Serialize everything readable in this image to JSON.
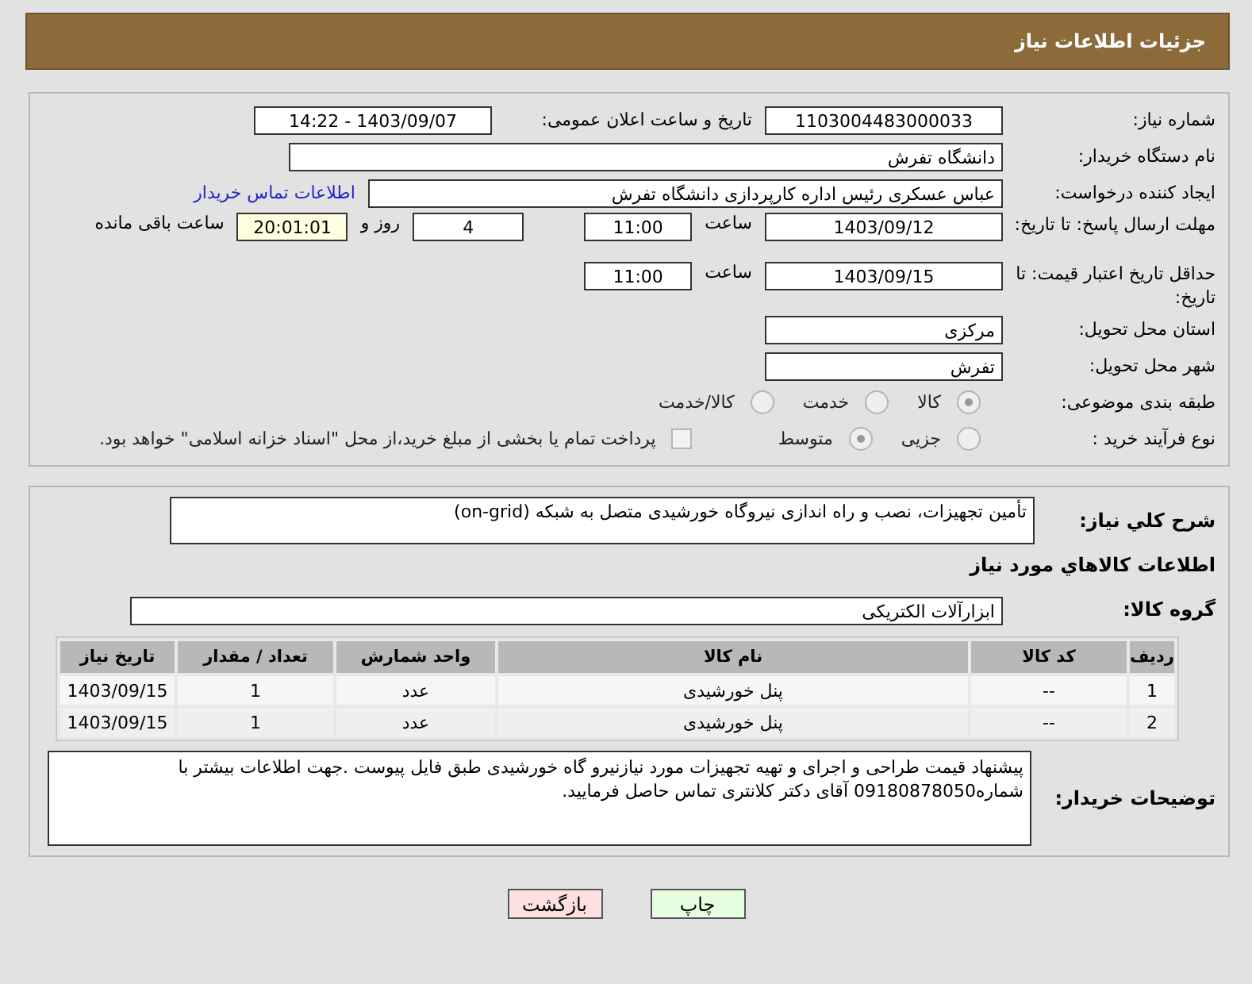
{
  "header": {
    "title": "جزئیات اطلاعات نیاز"
  },
  "need_number": {
    "label": "شماره نیاز:",
    "value": "1103004483000033"
  },
  "announce": {
    "label": "تاریخ و ساعت اعلان عمومی:",
    "value": "1403/09/07 - 14:22"
  },
  "buyer_org": {
    "label": "نام دستگاه خریدار:",
    "value": "دانشگاه تفرش"
  },
  "requester": {
    "label": "ایجاد کننده درخواست:",
    "value": "عباس عسکری رئیس اداره کارپردازی دانشگاه تفرش",
    "link": "اطلاعات تماس خریدار"
  },
  "response_deadline": {
    "label": "مهلت ارسال پاسخ: تا تاریخ:",
    "date": "1403/09/12",
    "time_label": "ساعت",
    "time": "11:00",
    "days": "4",
    "days_label": "روز و",
    "remaining": "20:01:01",
    "remaining_label": "ساعت باقی مانده"
  },
  "price_validity": {
    "label": "حداقل تاریخ اعتبار قیمت: تا تاریخ:",
    "date": "1403/09/15",
    "time_label": "ساعت",
    "time": "11:00"
  },
  "province": {
    "label": "استان محل تحویل:",
    "value": "مرکزی"
  },
  "city": {
    "label": "شهر محل تحویل:",
    "value": "تفرش"
  },
  "category": {
    "label": "طبقه بندی موضوعی:",
    "options": [
      {
        "label": "کالا",
        "selected": true
      },
      {
        "label": "خدمت",
        "selected": false
      },
      {
        "label": "کالا/خدمت",
        "selected": false
      }
    ]
  },
  "purchase_process": {
    "label": "نوع فرآیند خرید :",
    "options": [
      {
        "label": "جزیی",
        "selected": false
      },
      {
        "label": "متوسط",
        "selected": true
      }
    ],
    "treasury": {
      "label": "پرداخت تمام یا بخشی از مبلغ خرید،از محل \"اسناد خزانه اسلامی\" خواهد بود.",
      "checked": false
    }
  },
  "description": {
    "label": "شرح کلي نياز:",
    "value": "تأمین تجهیزات، نصب و راه اندازی نیروگاه خورشیدی متصل به شبکه (on-grid)"
  },
  "goods_heading": "اطلاعات کالاهاي مورد نياز",
  "goods_group": {
    "label": "گروه کالا:",
    "value": "ابزارآلات الکتریکی"
  },
  "table": {
    "columns": [
      "ردیف",
      "کد کالا",
      "نام کالا",
      "واحد شمارش",
      "تعداد / مقدار",
      "تاریخ نیاز"
    ],
    "rows": [
      [
        "1",
        "--",
        "پنل خورشیدی",
        "عدد",
        "1",
        "1403/09/15"
      ],
      [
        "2",
        "--",
        "پنل خورشیدی",
        "عدد",
        "1",
        "1403/09/15"
      ]
    ]
  },
  "buyer_notes": {
    "label": "توضیحات خریدار:",
    "value": "پیشنهاد قیمت طراحی و اجرای و تهیه تجهیزات مورد نیازنیرو گاه خورشیدی طبق فایل پیوست .جهت اطلاعات بیشتر با شماره09180878050  آقای دکتر کلانتری تماس حاصل فرمایید."
  },
  "buttons": [
    {
      "label": "چاپ",
      "kind": "print"
    },
    {
      "label": "بازگشت",
      "kind": "back"
    }
  ]
}
